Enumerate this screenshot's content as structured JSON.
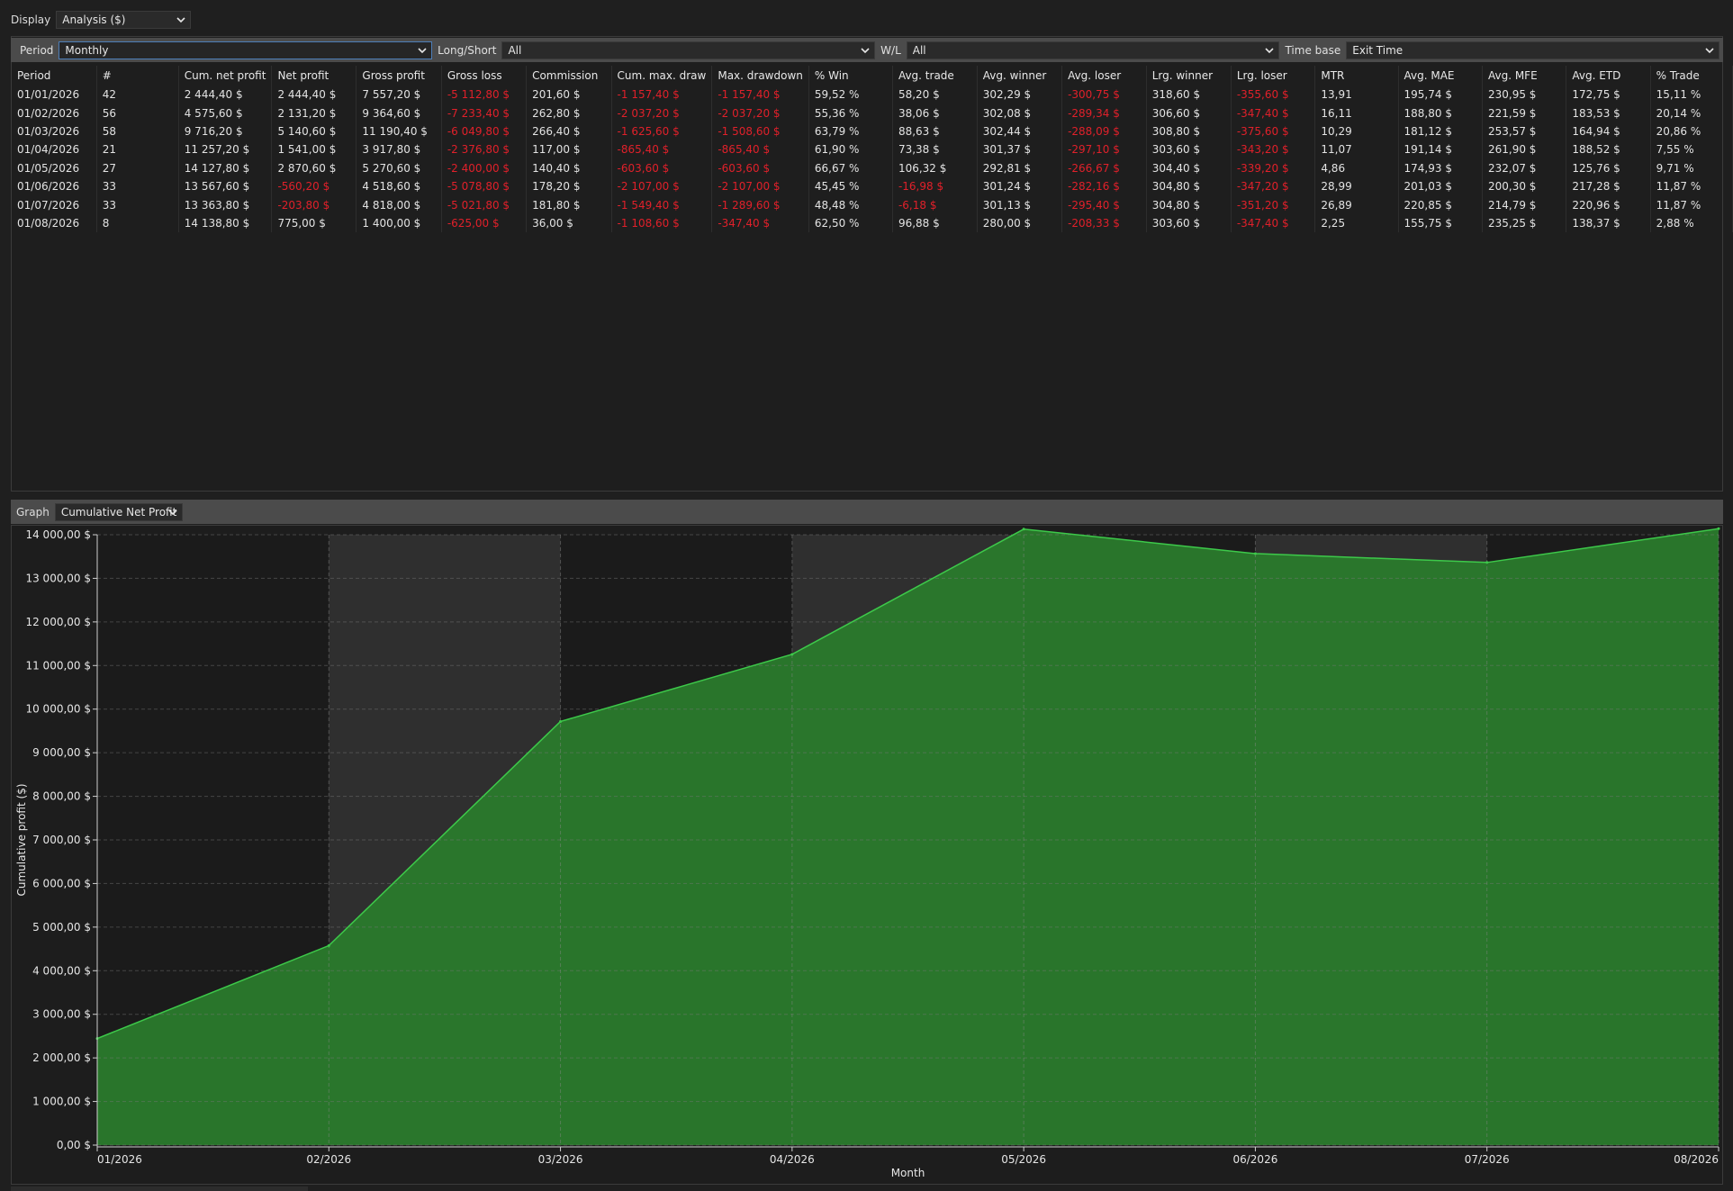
{
  "display": {
    "label": "Display",
    "value": "Analysis ($)"
  },
  "filters": {
    "period": {
      "label": "Period",
      "value": "Monthly"
    },
    "long_short": {
      "label": "Long/Short",
      "value": "All"
    },
    "wl": {
      "label": "W/L",
      "value": "All"
    },
    "time_base": {
      "label": "Time base",
      "value": "Exit Time"
    }
  },
  "table": {
    "columns": [
      "Period",
      "#",
      "Cum. net profit",
      "Net profit",
      "Gross profit",
      "Gross loss",
      "Commission",
      "Cum. max. draw",
      "Max. drawdown",
      "% Win",
      "Avg. trade",
      "Avg. winner",
      "Avg. loser",
      "Lrg. winner",
      "Lrg. loser",
      "MTR",
      "Avg. MAE",
      "Avg. MFE",
      "Avg. ETD",
      "% Trade"
    ],
    "rows": [
      [
        "01/01/2026",
        "42",
        "2 444,40 $",
        "2 444,40 $",
        "7 557,20 $",
        "-5 112,80 $",
        "201,60 $",
        "-1 157,40 $",
        "-1 157,40 $",
        "59,52 %",
        "58,20 $",
        "302,29 $",
        "-300,75 $",
        "318,60 $",
        "-355,60 $",
        "13,91",
        "195,74 $",
        "230,95 $",
        "172,75 $",
        "15,11 %"
      ],
      [
        "01/02/2026",
        "56",
        "4 575,60 $",
        "2 131,20 $",
        "9 364,60 $",
        "-7 233,40 $",
        "262,80 $",
        "-2 037,20 $",
        "-2 037,20 $",
        "55,36 %",
        "38,06 $",
        "302,08 $",
        "-289,34 $",
        "306,60 $",
        "-347,40 $",
        "16,11",
        "188,80 $",
        "221,59 $",
        "183,53 $",
        "20,14 %"
      ],
      [
        "01/03/2026",
        "58",
        "9 716,20 $",
        "5 140,60 $",
        "11 190,40 $",
        "-6 049,80 $",
        "266,40 $",
        "-1 625,60 $",
        "-1 508,60 $",
        "63,79 %",
        "88,63 $",
        "302,44 $",
        "-288,09 $",
        "308,80 $",
        "-375,60 $",
        "10,29",
        "181,12 $",
        "253,57 $",
        "164,94 $",
        "20,86 %"
      ],
      [
        "01/04/2026",
        "21",
        "11 257,20 $",
        "1 541,00 $",
        "3 917,80 $",
        "-2 376,80 $",
        "117,00 $",
        "-865,40 $",
        "-865,40 $",
        "61,90 %",
        "73,38 $",
        "301,37 $",
        "-297,10 $",
        "303,60 $",
        "-343,20 $",
        "11,07",
        "191,14 $",
        "261,90 $",
        "188,52 $",
        "7,55 %"
      ],
      [
        "01/05/2026",
        "27",
        "14 127,80 $",
        "2 870,60 $",
        "5 270,60 $",
        "-2 400,00 $",
        "140,40 $",
        "-603,60 $",
        "-603,60 $",
        "66,67 %",
        "106,32 $",
        "292,81 $",
        "-266,67 $",
        "304,40 $",
        "-339,20 $",
        "4,86",
        "174,93 $",
        "232,07 $",
        "125,76 $",
        "9,71 %"
      ],
      [
        "01/06/2026",
        "33",
        "13 567,60 $",
        "-560,20 $",
        "4 518,60 $",
        "-5 078,80 $",
        "178,20 $",
        "-2 107,00 $",
        "-2 107,00 $",
        "45,45 %",
        "-16,98 $",
        "301,24 $",
        "-282,16 $",
        "304,80 $",
        "-347,20 $",
        "28,99",
        "201,03 $",
        "200,30 $",
        "217,28 $",
        "11,87 %"
      ],
      [
        "01/07/2026",
        "33",
        "13 363,80 $",
        "-203,80 $",
        "4 818,00 $",
        "-5 021,80 $",
        "181,80 $",
        "-1 549,40 $",
        "-1 289,60 $",
        "48,48 %",
        "-6,18 $",
        "301,13 $",
        "-295,40 $",
        "304,80 $",
        "-351,20 $",
        "26,89",
        "220,85 $",
        "214,79 $",
        "220,96 $",
        "11,87 %"
      ],
      [
        "01/08/2026",
        "8",
        "14 138,80 $",
        "775,00 $",
        "1 400,00 $",
        "-625,00 $",
        "36,00 $",
        "-1 108,60 $",
        "-347,40 $",
        "62,50 %",
        "96,88 $",
        "280,00 $",
        "-208,33 $",
        "303,60 $",
        "-347,40 $",
        "2,25",
        "155,75 $",
        "235,25 $",
        "138,37 $",
        "2,88 %"
      ]
    ]
  },
  "graph": {
    "label": "Graph",
    "value": "Cumulative Net Profit"
  },
  "colors": {
    "area_fill": "#2a7a2c",
    "area_line": "#3dc94a",
    "negative": "#e0202a",
    "band": "#2f2f2f"
  },
  "chart_data": {
    "type": "area",
    "x": [
      "01/2026",
      "02/2026",
      "03/2026",
      "04/2026",
      "05/2026",
      "06/2026",
      "07/2026",
      "08/2026"
    ],
    "series": [
      {
        "values": [
          2444.4,
          4575.6,
          9716.2,
          11257.2,
          14127.8,
          13567.6,
          13363.8,
          14138.8
        ]
      }
    ],
    "xlabel": "Month",
    "ylabel": "Cumulative profit ($)",
    "ylim": [
      0,
      14000
    ],
    "yticks": [
      "0,00 $",
      "1 000,00 $",
      "2 000,00 $",
      "3 000,00 $",
      "4 000,00 $",
      "5 000,00 $",
      "6 000,00 $",
      "7 000,00 $",
      "8 000,00 $",
      "9 000,00 $",
      "10 000,00 $",
      "11 000,00 $",
      "12 000,00 $",
      "13 000,00 $",
      "14 000,00 $"
    ],
    "grid": true
  }
}
